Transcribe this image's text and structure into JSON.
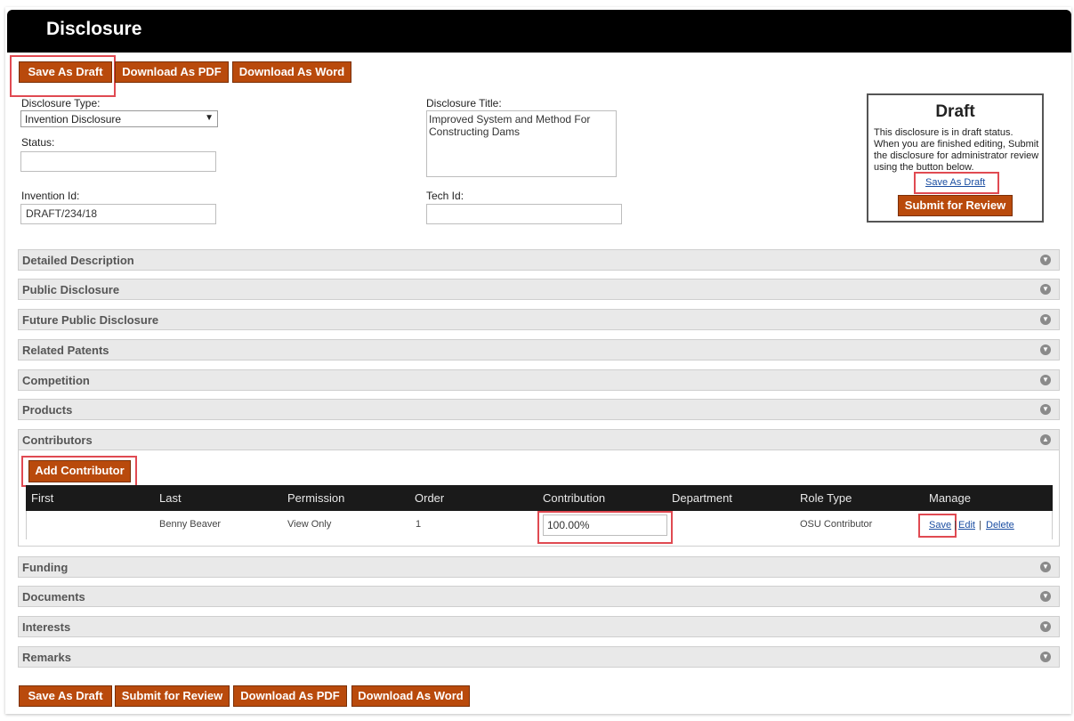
{
  "header": {
    "title": "Disclosure"
  },
  "top_buttons": {
    "save_draft": "Save As Draft",
    "download_pdf": "Download As PDF",
    "download_word": "Download As Word"
  },
  "form": {
    "disclosure_type_label": "Disclosure Type:",
    "disclosure_type_value": "Invention Disclosure",
    "status_label": "Status:",
    "status_value": "",
    "invention_id_label": "Invention Id:",
    "invention_id_value": "DRAFT/234/18",
    "disclosure_title_label": "Disclosure Title:",
    "disclosure_title_value": "Improved System and Method For Constructing Dams",
    "tech_id_label": "Tech Id:",
    "tech_id_value": ""
  },
  "status_box": {
    "title": "Draft",
    "text": "This disclosure is in draft status. When you are finished editing, Submit the disclosure for administrator review using the button below.",
    "save_link": "Save As Draft",
    "submit_button": "Submit for Review"
  },
  "sections": {
    "detailed_description": "Detailed Description",
    "public_disclosure": "Public Disclosure",
    "future_public_disclosure": "Future Public Disclosure",
    "related_patents": "Related Patents",
    "competition": "Competition",
    "products": "Products",
    "contributors": "Contributors",
    "funding": "Funding",
    "documents": "Documents",
    "interests": "Interests",
    "remarks": "Remarks"
  },
  "contributors": {
    "add_button": "Add Contributor",
    "columns": [
      "First",
      "Last",
      "Permission",
      "Order",
      "Contribution",
      "Department",
      "Role Type",
      "Manage"
    ],
    "row": {
      "first": "",
      "last": "Benny Beaver",
      "permission": "View Only",
      "order": "1",
      "contribution": "100.00%",
      "department": "",
      "role_type": "OSU Contributor",
      "save": "Save",
      "edit": "Edit",
      "delete": "Delete",
      "separator": "|"
    }
  },
  "bottom_buttons": {
    "save_draft": "Save As Draft",
    "submit_review": "Submit for Review",
    "download_pdf": "Download As PDF",
    "download_word": "Download As Word"
  },
  "colors": {
    "accent": "#b94a0c",
    "highlight": "#e04a52",
    "header_bg": "#000000"
  },
  "icons": {
    "collapsed": "chevron-down-icon",
    "expanded": "chevron-up-icon"
  }
}
